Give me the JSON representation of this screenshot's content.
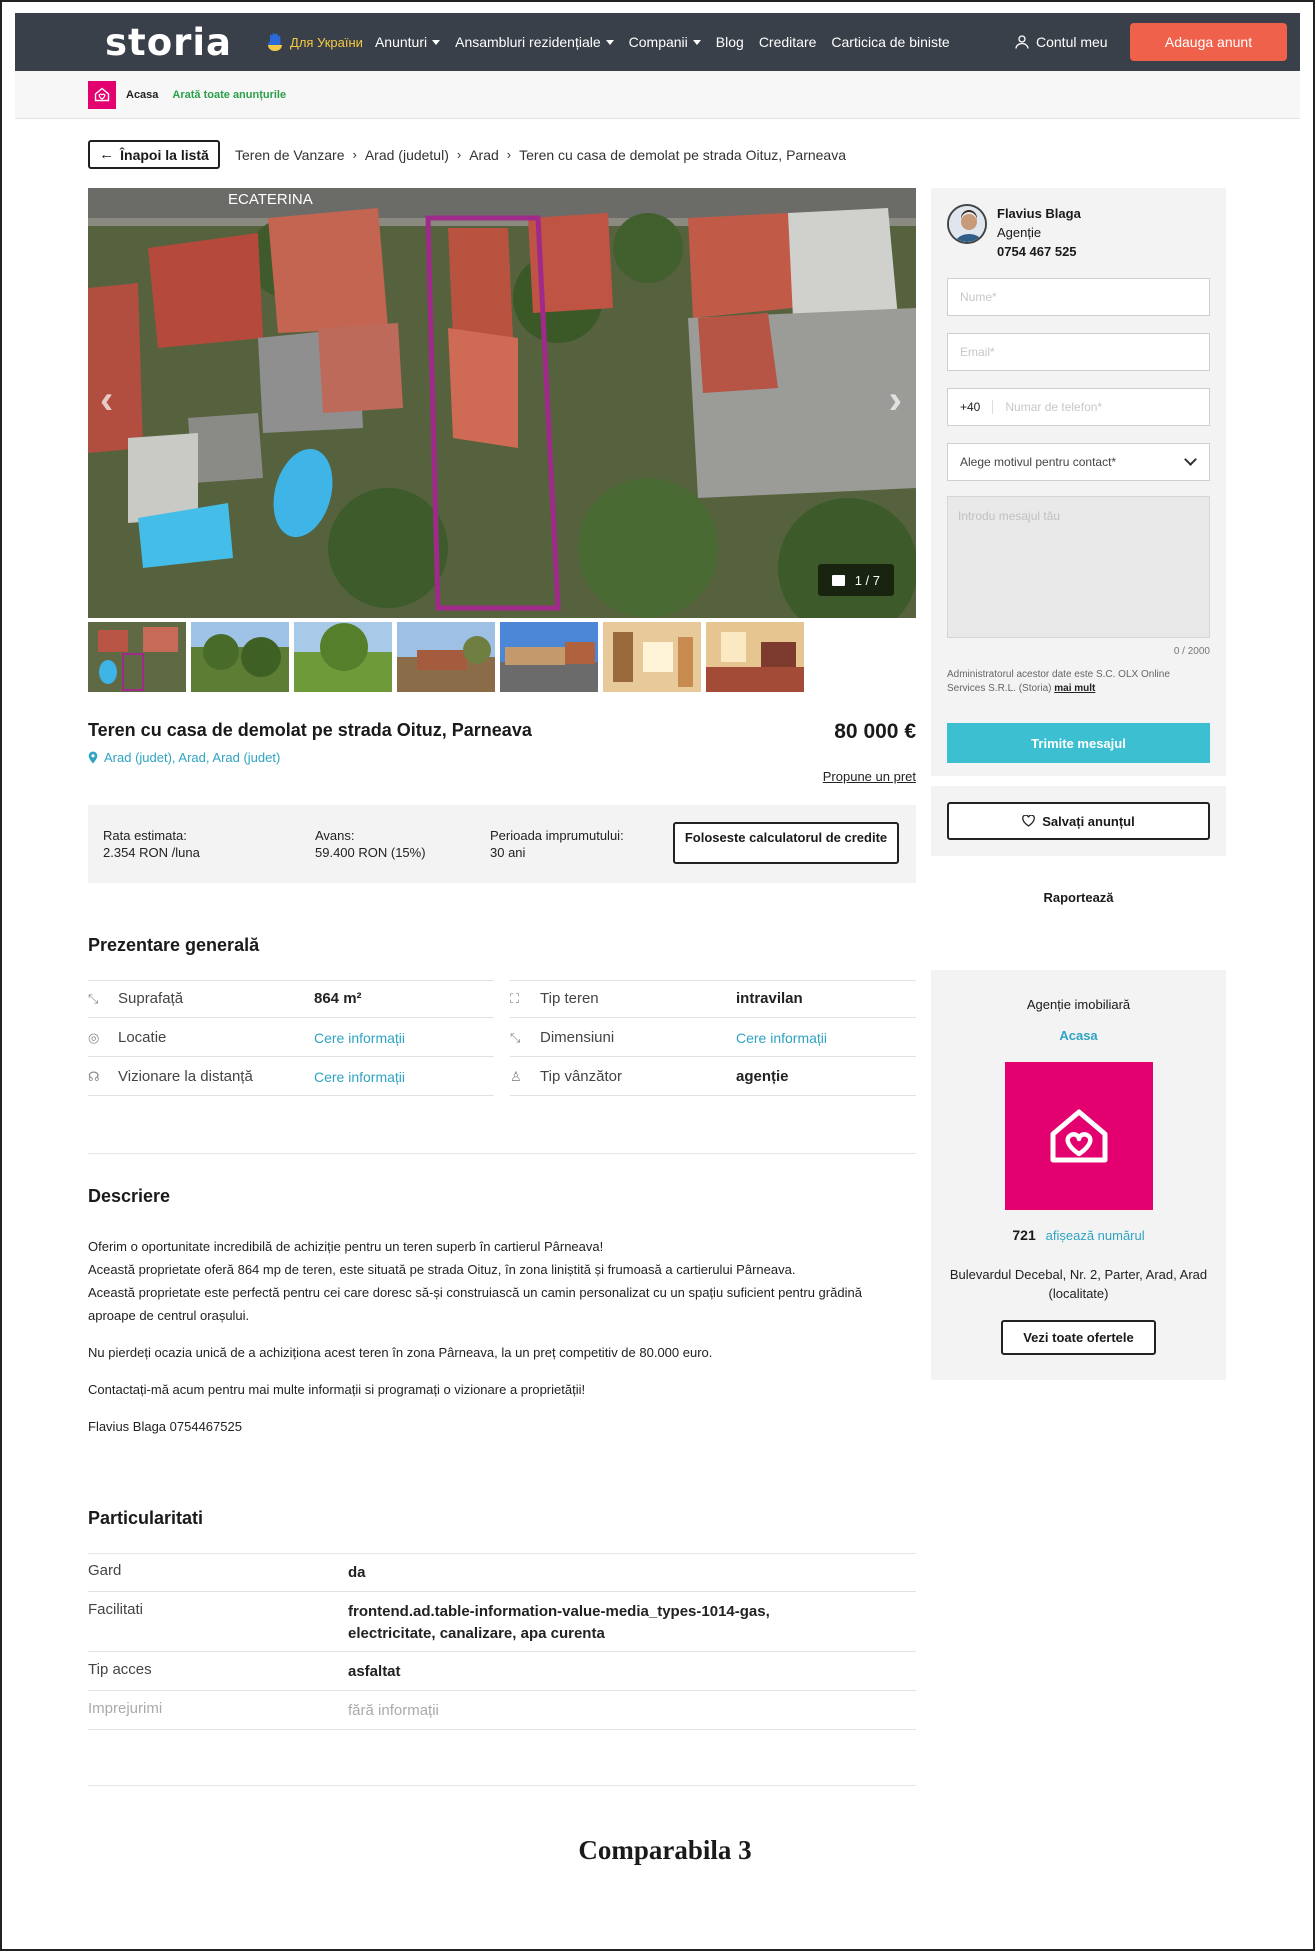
{
  "nav": {
    "logo": "storia",
    "ukraine": "Для України",
    "links": [
      {
        "label": "Anunturi",
        "dropdown": true
      },
      {
        "label": "Ansambluri rezidențiale",
        "dropdown": true
      },
      {
        "label": "Companii",
        "dropdown": true
      },
      {
        "label": "Blog",
        "dropdown": false
      },
      {
        "label": "Creditare",
        "dropdown": false
      },
      {
        "label": "Carticica de biniste",
        "dropdown": false
      }
    ],
    "account": "Contul meu",
    "add_ad": "Adauga anunt"
  },
  "subbar": {
    "agency": "Acasa",
    "all_ads": "Arată toate anunțurile"
  },
  "breadcrumb": {
    "back": "Înapoi la listă",
    "items": [
      "Teren de Vanzare",
      "Arad (judetul)",
      "Arad",
      "Teren cu casa de demolat pe strada Oituz, Parneava"
    ]
  },
  "gallery": {
    "map_label": "ECATERINA",
    "counter": "1 / 7"
  },
  "listing": {
    "title": "Teren cu casa de demolat pe strada Oituz, Parneava",
    "price": "80 000 €",
    "location": "Arad (judet), Arad, Arad (judet)",
    "propose": "Propune un pret"
  },
  "credit": {
    "rate_label": "Rata estimata:",
    "rate_value": "2.354 RON /luna",
    "advance_label": "Avans:",
    "advance_value": "59.400 RON (15%)",
    "period_label": "Perioada imprumutului:",
    "period_value": "30 ani",
    "calc_button": "Foloseste calculatorul de credite"
  },
  "overview": {
    "heading": "Prezentare generală",
    "rows": [
      {
        "label": "Suprafață",
        "value": "864 m²",
        "link": false,
        "icon": "area-icon"
      },
      {
        "label": "Tip teren",
        "value": "intravilan",
        "link": false,
        "icon": "land-type-icon"
      },
      {
        "label": "Locatie",
        "value": "Cere informații",
        "link": true,
        "icon": "location-icon"
      },
      {
        "label": "Dimensiuni",
        "value": "Cere informații",
        "link": true,
        "icon": "dimensions-icon"
      },
      {
        "label": "Vizionare la distanță",
        "value": "Cere informații",
        "link": true,
        "icon": "remote-view-icon"
      },
      {
        "label": "Tip vânzător",
        "value": "agenție",
        "link": false,
        "icon": "seller-icon"
      }
    ]
  },
  "description": {
    "heading": "Descriere",
    "paragraphs": [
      "Oferim o oportunitate incredibilă de achiziție pentru un teren superb în cartierul Pârneava!\nAceastă proprietate oferă 864 mp de teren, este situată pe strada Oituz, în zona liniștită și frumoasă a cartierului Pârneava.\nAceastă proprietate este perfectă pentru cei care doresc să-și construiască un camin personalizat cu un spațiu suficient pentru grădină aproape de centrul orașului.",
      "Nu pierdeți ocazia unică de a achiziționa acest teren în zona Pârneava, la un preț competitiv de 80.000 euro.",
      "Contactați-mă acum pentru mai multe informații si programați o vizionare a proprietății!",
      "Flavius Blaga 0754467525"
    ]
  },
  "features": {
    "heading": "Particularitati",
    "rows": [
      {
        "label": "Gard",
        "value": "da"
      },
      {
        "label": "Facilitati",
        "value": "frontend.ad.table-information-value-media_types-1014-gas, electricitate, canalizare, apa curenta"
      },
      {
        "label": "Tip acces",
        "value": "asfaltat"
      },
      {
        "label": "Imprejurimi",
        "value": "fără informații"
      }
    ]
  },
  "caption": "Comparabila 3",
  "contact": {
    "agent_name": "Flavius Blaga",
    "agent_role": "Agenție",
    "agent_phone": "0754 467 525",
    "name_placeholder": "Nume*",
    "email_placeholder": "Email*",
    "phone_prefix": "+40",
    "phone_placeholder": "Numar de telefon*",
    "reason_select": "Alege motivul pentru contact*",
    "message_placeholder": "Introdu mesajul tău",
    "char_count": "0 / 2000",
    "admin_note": "Administratorul acestor date este S.C. OLX Online Services S.R.L. (Storia)",
    "admin_more": "mai mult",
    "send": "Trimite mesajul",
    "save": "Salvați anunțul",
    "report": "Raportează"
  },
  "agency": {
    "type": "Agenție imobiliară",
    "name": "Acasa",
    "count": "721",
    "show_number": "afișează numărul",
    "address": "Bulevardul Decebal, Nr. 2, Parter, Arad, Arad (localitate)",
    "offers": "Vezi toate ofertele"
  },
  "colors": {
    "nav_bg": "#3a4049",
    "accent_orange": "#f0614b",
    "accent_teal": "#3dbfd2",
    "link_blue": "#2fa3c2",
    "agency_pink": "#e3006f",
    "highlight_purple": "#a02a8a"
  }
}
